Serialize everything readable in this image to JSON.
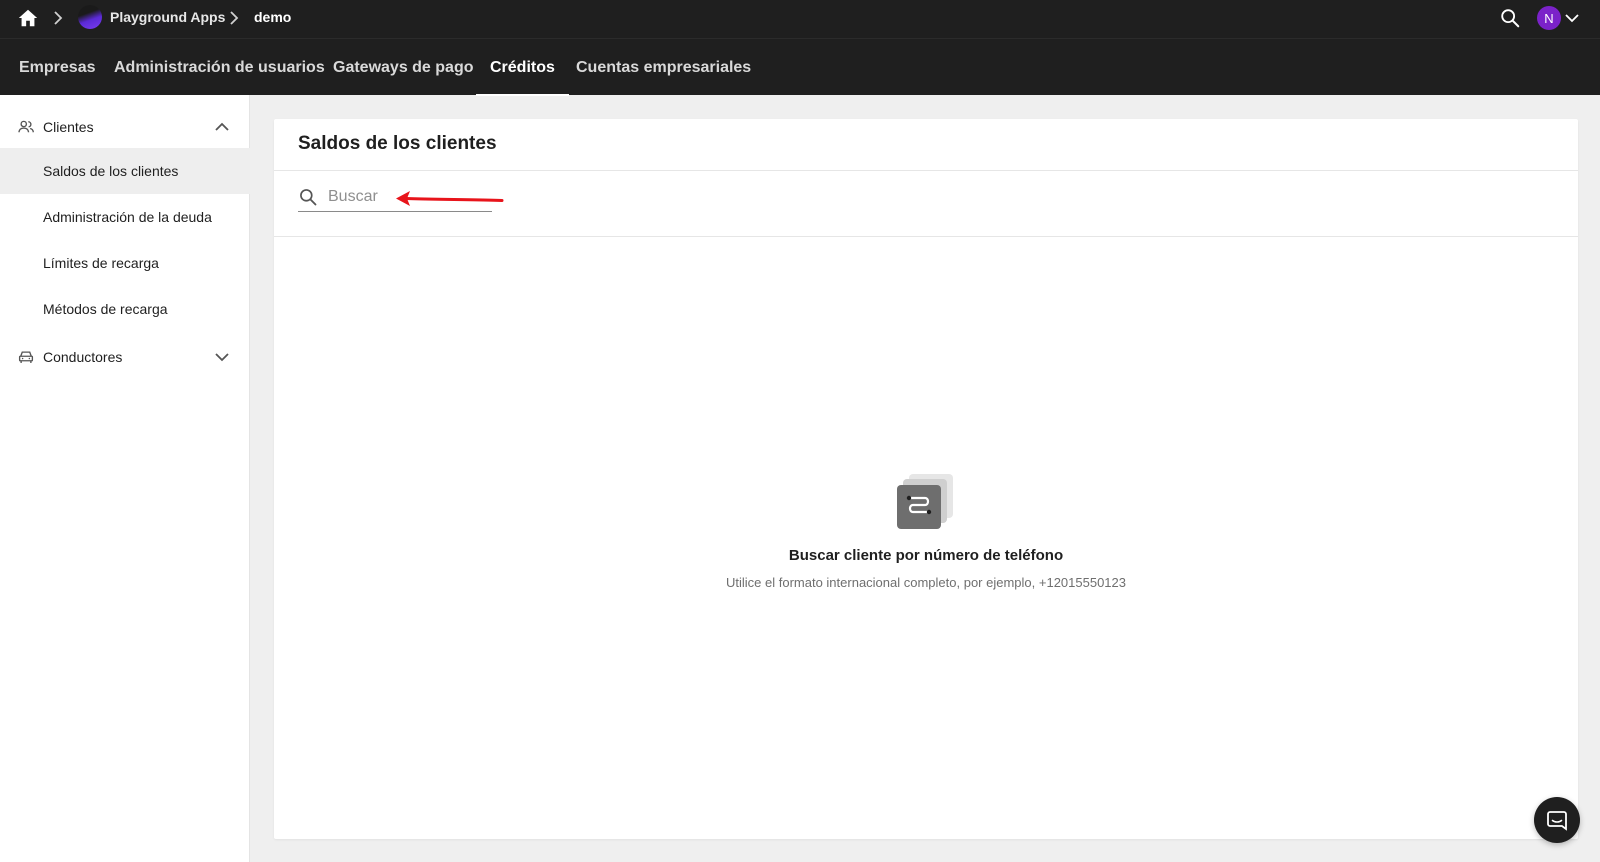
{
  "topbar": {
    "breadcrumbs": [
      {
        "label": "Playground Apps"
      },
      {
        "label": "demo"
      }
    ],
    "user_initial": "N"
  },
  "nav": {
    "tabs": [
      {
        "label": "Empresas"
      },
      {
        "label": "Administración de usuarios"
      },
      {
        "label": "Gateways de pago"
      },
      {
        "label": "Créditos",
        "active": true
      },
      {
        "label": "Cuentas empresariales"
      }
    ]
  },
  "sidebar": {
    "groups": [
      {
        "label": "Clientes",
        "expanded": true,
        "items": [
          {
            "label": "Saldos de los clientes",
            "active": true
          },
          {
            "label": "Administración de la deuda"
          },
          {
            "label": "Límites de recarga"
          },
          {
            "label": "Métodos de recarga"
          }
        ]
      },
      {
        "label": "Conductores",
        "expanded": false
      }
    ]
  },
  "main": {
    "title": "Saldos de los clientes",
    "search": {
      "placeholder": "Buscar",
      "value": ""
    },
    "empty_state": {
      "title": "Buscar cliente por número de teléfono",
      "subtitle": "Utilice el formato internacional completo, por ejemplo, +12015550123"
    }
  },
  "colors": {
    "header_bg": "#1f1f1f",
    "avatar_bg": "#7b22c9",
    "annotation_arrow": "#e8141b"
  }
}
